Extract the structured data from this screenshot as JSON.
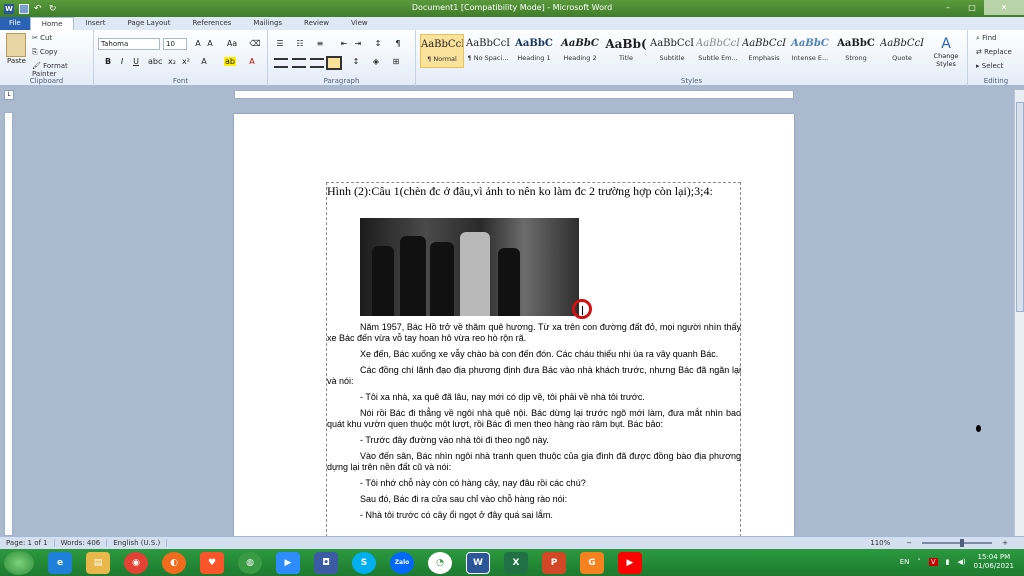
{
  "window": {
    "title": "Document1 [Compatibility Mode] - Microsoft Word",
    "exit_label": "exit"
  },
  "tabs": [
    "File",
    "Home",
    "Insert",
    "Page Layout",
    "References",
    "Mailings",
    "Review",
    "View"
  ],
  "ribbon": {
    "clipboard": {
      "label": "Clipboard",
      "paste": "Paste",
      "cut": "Cut",
      "copy": "Copy",
      "format_painter": "Format Painter"
    },
    "font": {
      "label": "Font",
      "name": "Tahoma",
      "size": "10"
    },
    "paragraph": {
      "label": "Paragraph"
    },
    "styles": {
      "label": "Styles",
      "items": [
        {
          "preview": "AaBbCcI",
          "name": "¶ Normal"
        },
        {
          "preview": "AaBbCcI",
          "name": "¶ No Spaci..."
        },
        {
          "preview": "AaBbC",
          "name": "Heading 1"
        },
        {
          "preview": "AaBbC",
          "name": "Heading 2"
        },
        {
          "preview": "AaBb(",
          "name": "Title"
        },
        {
          "preview": "AaBbCcI",
          "name": "Subtitle"
        },
        {
          "preview": "AaBbCcI",
          "name": "Subtle Em..."
        },
        {
          "preview": "AaBbCcI",
          "name": "Emphasis"
        },
        {
          "preview": "AaBbC",
          "name": "Intense E..."
        },
        {
          "preview": "AaBbC",
          "name": "Strong"
        },
        {
          "preview": "AaBbCcI",
          "name": "Quote"
        }
      ],
      "change_styles": "Change Styles"
    },
    "editing": {
      "label": "Editing",
      "find": "Find",
      "replace": "Replace",
      "select": "Select"
    }
  },
  "document": {
    "heading": "Hình (2):Câu 1(chèn đc ở đâu,vì ảnh to nên ko làm đc 2 trường hợp còn lại);3;4:",
    "paragraphs": [
      {
        "text": "Năm 1957, Bác Hồ trở về thăm quê hương. Từ xa trên con đường đất đỏ, mọi người nhìn thấy xe Bác đến vừa vỗ tay hoan hô vừa reo hò rộn rã.",
        "indent": "first"
      },
      {
        "text": "Xe đến, Bác xuống xe vẫy chào bà con đến đón. Các cháu thiếu nhi ùa ra vây quanh Bác.",
        "indent": "first"
      },
      {
        "text": "Các đồng chí lãnh đạo địa phương định đưa Bác vào nhà khách trước, nhưng Bác đã ngăn lại và nói:",
        "indent": "first"
      },
      {
        "text": "- Tôi xa nhà, xa quê đã lâu, nay mới có dịp về, tôi phải về nhà tôi trước.",
        "indent": "block"
      },
      {
        "text": "Nói rồi Bác đi thẳng về ngôi nhà quê nội. Bác dừng lại trước ngõ mới làm, đưa mắt nhìn bao quát khu vườn quen thuộc một lượt, rồi Bác đi men theo hàng rào râm bụt. Bác bảo:",
        "indent": "first"
      },
      {
        "text": "- Trước đây đường vào nhà tôi đi theo ngõ này.",
        "indent": "block"
      },
      {
        "text": "Vào đến sân, Bác nhìn ngôi nhà tranh quen thuộc của gia đình đã được đồng bào địa phương dựng lại trên nền đất cũ và nói:",
        "indent": "first"
      },
      {
        "text": "- Tôi nhớ chỗ này còn có hàng cây, nay đâu rồi các chú?",
        "indent": "block"
      },
      {
        "text": "Sau đó, Bác đi ra cửa sau chỉ vào chỗ hàng rào nói:",
        "indent": "block"
      },
      {
        "text": "- Nhà tôi trước có cây ổi ngọt ở đây quá sai lắm.",
        "indent": "block"
      }
    ]
  },
  "status": {
    "page": "Page: 1 of 1",
    "words": "Words: 406",
    "language": "English (U.S.)",
    "zoom": "110%"
  },
  "taskbar": {
    "language": "EN",
    "time": "15:04 PM",
    "date": "01/06/2021"
  }
}
